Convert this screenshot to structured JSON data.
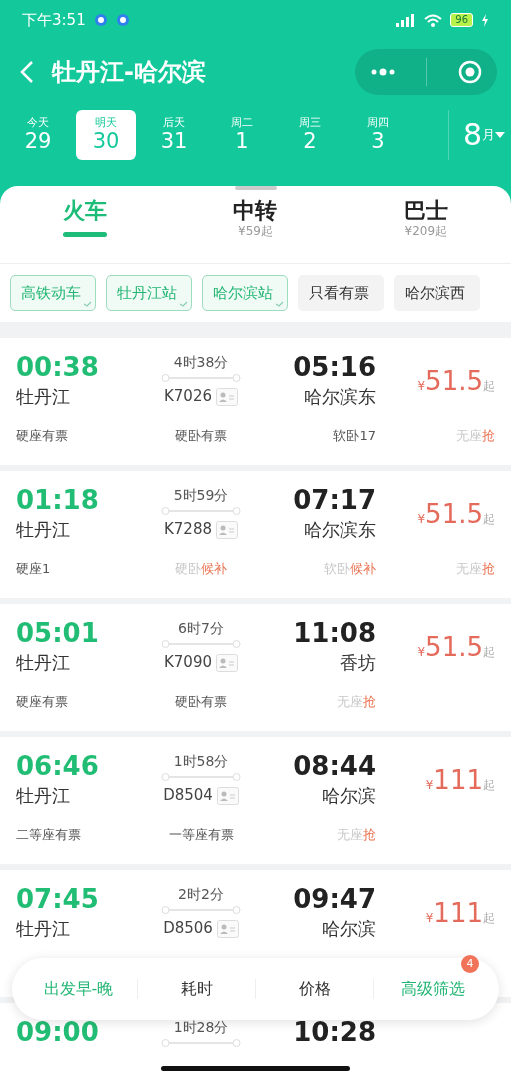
{
  "status_bar": {
    "time": "下午3:51",
    "battery": "96"
  },
  "header": {
    "title": "牡丹江-哈尔滨"
  },
  "dates": [
    {
      "weekday": "今天",
      "day": "29",
      "selected": false
    },
    {
      "weekday": "明天",
      "day": "30",
      "selected": true
    },
    {
      "weekday": "后天",
      "day": "31",
      "selected": false
    },
    {
      "weekday": "周二",
      "day": "1",
      "selected": false
    },
    {
      "weekday": "周三",
      "day": "2",
      "selected": false
    },
    {
      "weekday": "周四",
      "day": "3",
      "selected": false
    }
  ],
  "month": {
    "number": "8",
    "unit": "月"
  },
  "tabs": [
    {
      "label": "火车",
      "selected": true
    },
    {
      "label": "中转",
      "sub": "¥59起",
      "selected": false
    },
    {
      "label": "巴士",
      "sub": "¥209起",
      "selected": false
    }
  ],
  "filters": [
    {
      "label": "高铁动车",
      "selected": true
    },
    {
      "label": "牡丹江站",
      "selected": true
    },
    {
      "label": "哈尔滨站",
      "selected": true
    },
    {
      "label": "只看有票",
      "selected": false
    },
    {
      "label": "哈尔滨西",
      "selected": false
    }
  ],
  "trains": [
    {
      "depart": "00:38",
      "from": "牡丹江",
      "duration": "4时38分",
      "number": "K7026",
      "arrive": "05:16",
      "to": "哈尔滨东",
      "currency": "¥",
      "price": "51.5",
      "suffix": "起",
      "seats": [
        {
          "name": "硬座",
          "status": "有票",
          "kind": "available"
        },
        {
          "name": "硬卧",
          "status": "有票",
          "kind": "available"
        },
        {
          "name": "软卧",
          "status": "17",
          "kind": "available"
        },
        {
          "name": "无座",
          "status": "抢",
          "kind": "grab"
        }
      ]
    },
    {
      "depart": "01:18",
      "from": "牡丹江",
      "duration": "5时59分",
      "number": "K7288",
      "arrive": "07:17",
      "to": "哈尔滨东",
      "currency": "¥",
      "price": "51.5",
      "suffix": "起",
      "seats": [
        {
          "name": "硬座",
          "status": "1",
          "kind": "available"
        },
        {
          "name": "硬卧",
          "status": "候补",
          "kind": "grab"
        },
        {
          "name": "软卧",
          "status": "候补",
          "kind": "grab"
        },
        {
          "name": "无座",
          "status": "抢",
          "kind": "grab"
        }
      ]
    },
    {
      "depart": "05:01",
      "from": "牡丹江",
      "duration": "6时7分",
      "number": "K7090",
      "arrive": "11:08",
      "to": "香坊",
      "currency": "¥",
      "price": "51.5",
      "suffix": "起",
      "seats": [
        {
          "name": "硬座",
          "status": "有票",
          "kind": "available"
        },
        {
          "name": "硬卧",
          "status": "有票",
          "kind": "available"
        },
        {
          "name": "无座",
          "status": "抢",
          "kind": "grab"
        }
      ]
    },
    {
      "depart": "06:46",
      "from": "牡丹江",
      "duration": "1时58分",
      "number": "D8504",
      "arrive": "08:44",
      "to": "哈尔滨",
      "currency": "¥",
      "price": "111",
      "suffix": "起",
      "seats": [
        {
          "name": "二等座",
          "status": "有票",
          "kind": "available"
        },
        {
          "name": "一等座",
          "status": "有票",
          "kind": "available"
        },
        {
          "name": "无座",
          "status": "抢",
          "kind": "grab"
        }
      ]
    },
    {
      "depart": "07:45",
      "from": "牡丹江",
      "duration": "2时2分",
      "number": "D8506",
      "arrive": "09:47",
      "to": "哈尔滨",
      "currency": "¥",
      "price": "111",
      "suffix": "起"
    },
    {
      "depart": "09:00",
      "duration": "1时28分",
      "arrive": "10:28"
    }
  ],
  "sort_bar": [
    {
      "label": "出发早-晚",
      "selected": true
    },
    {
      "label": "耗时",
      "selected": false
    },
    {
      "label": "价格",
      "selected": false
    },
    {
      "label": "高级筛选",
      "selected": true,
      "badge": "4"
    }
  ]
}
